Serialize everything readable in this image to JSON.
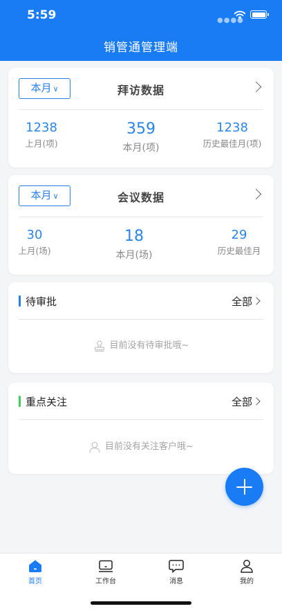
{
  "status": {
    "time": "5:59"
  },
  "app": {
    "title": "销管通管理端",
    "accent": "#1a7cf5"
  },
  "visit": {
    "period": "本月",
    "title": "拜访数据",
    "last_month": {
      "value": "1238",
      "label": "上月(项)"
    },
    "this_month": {
      "value": "359",
      "label": "本月(项)"
    },
    "best": {
      "value": "1238",
      "label": "历史最佳月(项)"
    }
  },
  "meeting": {
    "period": "本月",
    "title": "会议数据",
    "last_month": {
      "value": "30",
      "label": "上月(场)"
    },
    "this_month": {
      "value": "18",
      "label": "本月(场)"
    },
    "best": {
      "value": "29",
      "label": "历史最佳月"
    }
  },
  "pending": {
    "title": "待审批",
    "all": "全部",
    "bar_color": "#2a7fe6",
    "empty": "目前没有待审批哦~"
  },
  "focus": {
    "title": "重点关注",
    "all": "全部",
    "bar_color": "#3ccf5a",
    "empty": "目前没有关注客户哦~"
  },
  "tabs": [
    {
      "label": "首页",
      "icon": "home-icon",
      "active": true
    },
    {
      "label": "工作台",
      "icon": "laptop-icon",
      "active": false
    },
    {
      "label": "消息",
      "icon": "message-icon",
      "active": false
    },
    {
      "label": "我的",
      "icon": "person-icon",
      "active": false
    }
  ]
}
